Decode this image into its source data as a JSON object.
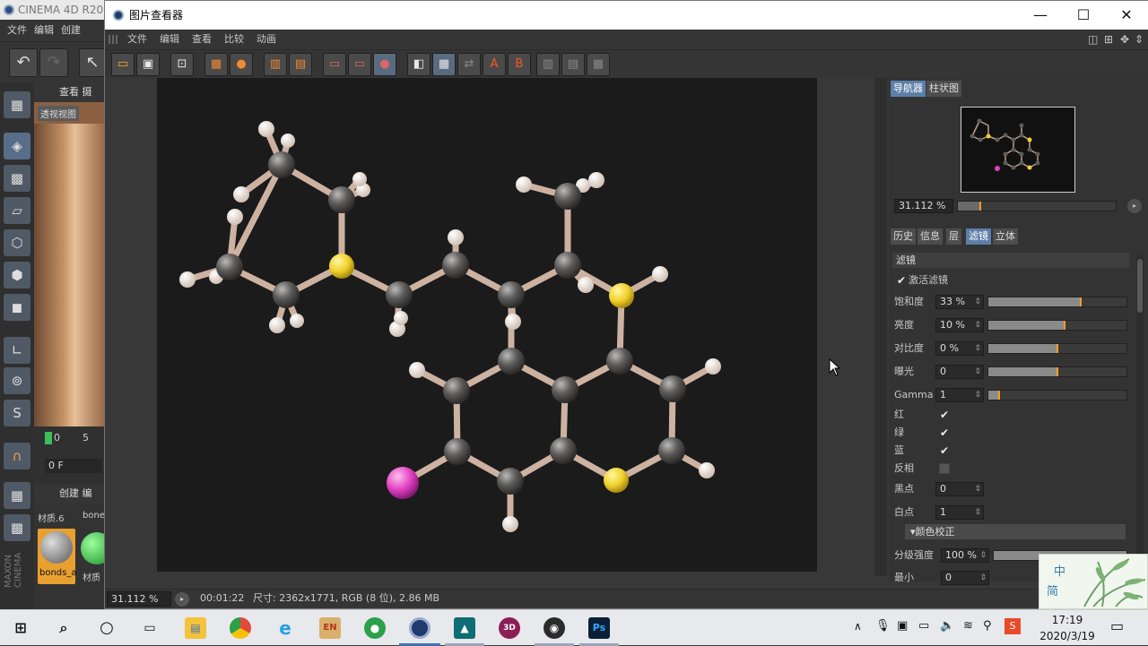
{
  "background_app": {
    "title": "CINEMA 4D R20",
    "menu": [
      "文件",
      "编辑",
      "创建"
    ],
    "viewport": {
      "tab_view": "查看",
      "tab_cam": "摄",
      "label": "透视视图"
    },
    "timeline": {
      "start": "0",
      "mark": "5",
      "frame": "0 F"
    },
    "materials": {
      "tab_create": "创建",
      "tab_edit": "编",
      "mat1": "材质.6",
      "mat2": "bone",
      "sel": "bonds_a",
      "mat3": "材质"
    },
    "side_logo": "MAXON CINEMA"
  },
  "window": {
    "title": "图片查看器",
    "controls": {
      "minimize": "—",
      "maximize": "☐",
      "close": "✕"
    },
    "menu": [
      "文件",
      "编辑",
      "查看",
      "比较",
      "动画"
    ],
    "toolbar_letters": {
      "a": "A",
      "b": "B"
    }
  },
  "navigator": {
    "tabs": [
      "导航器",
      "柱状图"
    ],
    "active_tab": "导航器",
    "zoom": "31.112 %"
  },
  "filter_panel": {
    "tabs": [
      "历史",
      "信息",
      "层",
      "滤镜",
      "立体"
    ],
    "active_tab": "滤镜",
    "section": "滤镜",
    "activate_label": "激活滤镜",
    "activate": true,
    "rows": [
      {
        "label": "饱和度",
        "value": "33 %",
        "level": 0.67
      },
      {
        "label": "亮度",
        "value": "10 %",
        "level": 0.55
      },
      {
        "label": "对比度",
        "value": "0 %",
        "level": 0.5
      },
      {
        "label": "曝光",
        "value": "0",
        "level": 0.5
      },
      {
        "label": "Gamma",
        "value": "1",
        "level": 0.08
      }
    ],
    "channels": [
      {
        "label": "红",
        "checked": true
      },
      {
        "label": "绿",
        "checked": true
      },
      {
        "label": "蓝",
        "checked": true
      },
      {
        "label": "反相",
        "checked": false
      }
    ],
    "black_point": {
      "label": "黑点",
      "value": "0"
    },
    "white_point": {
      "label": "白点",
      "value": "1"
    },
    "color_correction": "颜色校正",
    "grade": {
      "label": "分级强度",
      "value": "100 %"
    },
    "min": {
      "label": "最小",
      "value": "0"
    }
  },
  "status": {
    "zoom": "31.112 %",
    "time": "00:01:22",
    "info": "尺寸: 2362x1771, RGB (8 位), 2.86 MB"
  },
  "taskbar": {
    "icons": [
      "windows-icon",
      "search-icon",
      "cortana-icon",
      "task-view-icon",
      "file-explorer-icon",
      "chrome-icon",
      "ie-icon",
      "en-app-icon",
      "evernote-icon",
      "cinema4d-icon",
      "app3-icon",
      "app3d-icon",
      "obs-icon",
      "photoshop-icon"
    ],
    "time": "17:19",
    "date": "2020/3/19"
  },
  "ime": {
    "top": "中",
    "bottom": "简"
  },
  "colors": {
    "accent": "#5d7ea8",
    "slider_knob": "#f4a020",
    "carbon": "#5c5a58",
    "sulfur": "#f0d030",
    "iodine": "#e040c0",
    "hydrogen": "#f2e6dc"
  }
}
